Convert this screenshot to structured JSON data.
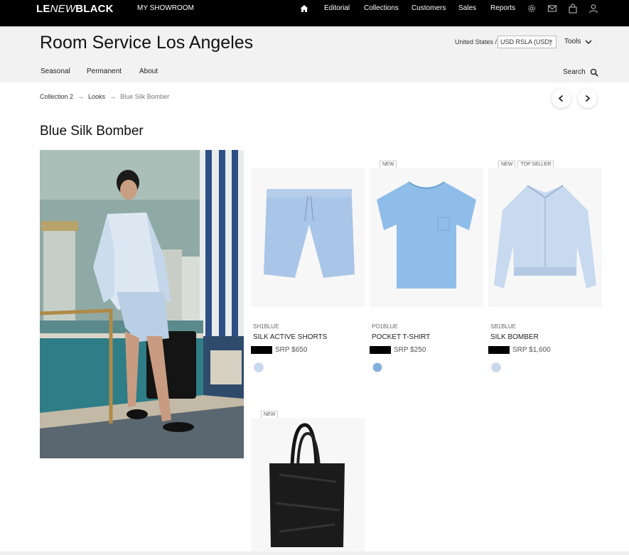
{
  "topnav": {
    "logo_prefix": "LE",
    "logo_italic": "NEW",
    "logo_suffix": "BLACK",
    "my_showroom": "MY SHOWROOM",
    "links": [
      "Editorial",
      "Collections",
      "Customers",
      "Sales",
      "Reports"
    ]
  },
  "header": {
    "title": "Room Service Los Angeles",
    "region": "United States /",
    "currency": "USD RSLA (USD)",
    "tools": "Tools",
    "subnav": [
      "Seasonal",
      "Permanent",
      "About"
    ],
    "search": "Search"
  },
  "breadcrumb": [
    "Collection 2",
    "Looks",
    "Blue Silk Bomber"
  ],
  "look_title": "Blue Silk Bomber",
  "products": [
    {
      "badges": [],
      "sku": "SH1BLUE",
      "name": "SILK ACTIVE SHORTS",
      "price": "SRP $650",
      "swatch": "#c8d8ee"
    },
    {
      "badges": [
        "NEW"
      ],
      "sku": "PO1BLUE",
      "name": "POCKET T-SHIRT",
      "price": "SRP $250",
      "swatch": "#7fb0dc"
    },
    {
      "badges": [
        "NEW",
        "TOP SELLER"
      ],
      "sku": "SB1BLUE",
      "name": "SILK BOMBER",
      "price": "SRP $1,600",
      "swatch": "#c8d8ee"
    },
    {
      "badges": [
        "NEW"
      ]
    }
  ],
  "colors": {
    "topbar": "#000000",
    "header_bg": "#f2f2f2",
    "accent_blue": "#8bb8e8"
  }
}
